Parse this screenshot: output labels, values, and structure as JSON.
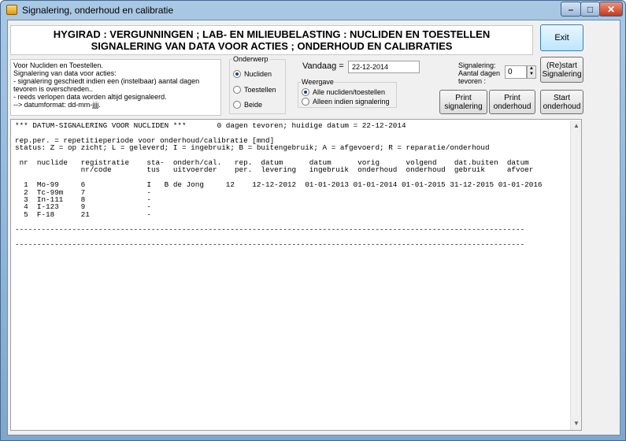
{
  "window": {
    "title": "Signalering, onderhoud en calibratie",
    "min_label": "–",
    "max_label": "□",
    "close_label": "✕"
  },
  "header": {
    "line1": "HYGIRAD : VERGUNNINGEN ; LAB- EN MILIEUBELASTING : NUCLIDEN EN TOESTELLEN",
    "line2": "SIGNALERING VAN DATA VOOR ACTIES  ;  ONDERHOUD EN CALIBRATIES"
  },
  "buttons": {
    "exit": "Exit",
    "restart": "(Re)start Signalering",
    "print_signalering": "Print signalering",
    "print_onderhoud": "Print onderhoud",
    "start_onderhoud": "Start onderhoud"
  },
  "info": {
    "lines": [
      "Voor Nucliden en Toestellen.",
      "Signalering van data voor acties:",
      "- signalering geschiedt indien een (instelbaar) aantal dagen tevoren is overschreden..",
      "- reeds verlopen data worden altijd gesignaleerd.",
      "--> datumformat: dd-mm-jjjj."
    ]
  },
  "onderwerp": {
    "title": "Onderwerp",
    "options": [
      "Nucliden",
      "Toestellen",
      "Beide"
    ],
    "selected": 0
  },
  "weergave": {
    "title": "Weergave",
    "options": [
      "Alle nucliden/toestellen",
      "Alleen indien signalering"
    ],
    "selected": 0
  },
  "vandaag": {
    "label": "Vandaag =",
    "value": "22-12-2014"
  },
  "signalering": {
    "label": "Signalering: Aantal dagen tevoren :",
    "value": "0"
  },
  "report": {
    "text": "*** DATUM-SIGNALERING VOOR NUCLIDEN ***       0 dagen tevoren; huidige datum = 22-12-2014\n\nrep.per. = repetitieperiode voor onderhoud/calibratie [mnd]\nstatus: Z = op zicht; L = geleverd; I = ingebruik; B = buitengebruik; A = afgevoerd; R = reparatie/onderhoud\n\n nr  nuclide   registratie    sta-  onderh/cal.   rep.  datum      datum      vorig      volgend    dat.buiten  datum\n               nr/code        tus   uitvoerder    per.  levering   ingebruik  onderhoud  onderhoud  gebruik     afvoer\n\n  1  Mo-99     6              I   B de Jong     12    12-12-2012  01-01-2013 01-01-2014 01-01-2015 31-12-2015 01-01-2016\n  2  Tc-99m    7              -\n  3  In-111    8              -\n  4  I-123     9              -\n  5  F-18      21             -\n\n--------------------------------------------------------------------------------------------------------------------\n\n--------------------------------------------------------------------------------------------------------------------"
  }
}
